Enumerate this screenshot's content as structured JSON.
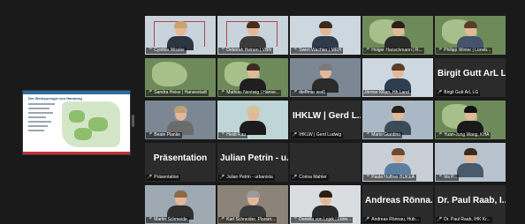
{
  "shared_screen": {
    "title": "Der Weinsprengel von Hamburg"
  },
  "colors": {
    "active_speaker": "#e8df4a",
    "muted_mic": "#e0433a"
  },
  "tiles": [
    {
      "label": "Cynthia Wissler",
      "big": ""
    },
    {
      "label": "Deborah Heinen | VBN",
      "big": ""
    },
    {
      "label": "Swen Wachter | MRH",
      "big": ""
    },
    {
      "label": "Holger Hanschmann | R...",
      "big": ""
    },
    {
      "label": "Philipp Winter | Lüneb...",
      "big": ""
    },
    {
      "label": "Sandra Heise | Hansestadt",
      "big": ""
    },
    {
      "label": "Mathias Nentwig | Hanse...",
      "big": ""
    },
    {
      "label": "dieffmar weiß",
      "big": ""
    },
    {
      "label": "Jörmar Kilian, Hh Land",
      "big": ""
    },
    {
      "label": "Birgit Gutt ArL LG",
      "big": "Birgit Gutt ArL LG"
    },
    {
      "label": "Beate Planke",
      "big": ""
    },
    {
      "label": "Heidi Rau",
      "big": ""
    },
    {
      "label": "IHKLW | Gerd Ludwig",
      "big": "IHKLW | Gerd L..."
    },
    {
      "label": "Mario Giardino",
      "big": ""
    },
    {
      "label": "Yuan-Jung Wang, KHA",
      "big": ""
    },
    {
      "label": "Präsentation",
      "big": "Präsentation"
    },
    {
      "label": "Julian Petrin - urbanista",
      "big": "Julian Petrin - u..."
    },
    {
      "label": "Corina Mahler",
      "big": ""
    },
    {
      "label": "Paula Hoffner BUKEA",
      "big": ""
    },
    {
      "label": "Iris P...",
      "big": ""
    },
    {
      "label": "Martin Schmeide",
      "big": ""
    },
    {
      "label": "Karl Schneider, Planun...",
      "big": ""
    },
    {
      "label": "Daniela von Lojek | Lüne...",
      "big": ""
    },
    {
      "label": "Andreas Rönnau, Hub...",
      "big": "Andreas Rönna..."
    },
    {
      "label": "Dr. Paul Raab, IHK Kr...",
      "big": "Dr. Paul Raab, I..."
    }
  ]
}
